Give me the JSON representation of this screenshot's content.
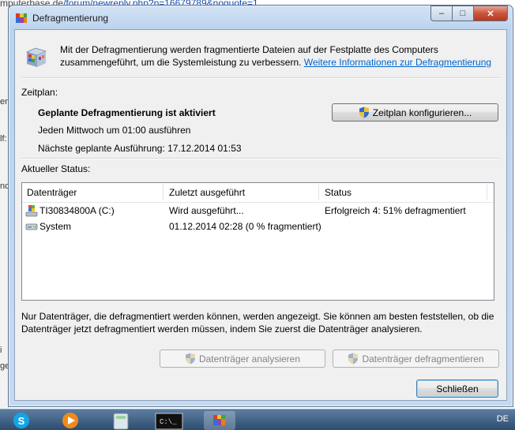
{
  "background": {
    "url_prefix": "mputerbase.de",
    "url_path": "/forum/newreply.php?p=16679789&noquote=1",
    "frag1": "en",
    "frag2": "lf:",
    "frag3": "nd",
    "frag4": "i",
    "frag5": "ge"
  },
  "window": {
    "title": "Defragmentierung",
    "minimize": "–",
    "maximize": "□",
    "close": "✕"
  },
  "intro": {
    "text": "Mit der Defragmentierung werden fragmentierte Dateien auf der Festplatte des Computers zusammengeführt, um die Systemleistung zu verbessern.",
    "link": "Weitere Informationen zur Defragmentierung"
  },
  "schedule": {
    "section_label": "Zeitplan:",
    "status": "Geplante Defragmentierung ist aktiviert",
    "run_time": "Jeden Mittwoch um 01:00 ausführen",
    "next_run": "Nächste geplante Ausführung: 17.12.2014 01:53",
    "configure_button": "Zeitplan konfigurieren..."
  },
  "current_status": {
    "section_label": "Aktueller Status:",
    "columns": [
      "Datenträger",
      "Zuletzt ausgeführt",
      "Status"
    ],
    "rows": [
      {
        "drive": "TI30834800A (C:)",
        "last_run": "Wird ausgeführt...",
        "status": "Erfolgreich 4: 51% defragmentiert",
        "icon": "windows-drive-icon"
      },
      {
        "drive": "System",
        "last_run": "01.12.2014 02:28 (0 % fragmentiert)",
        "status": "",
        "icon": "disk-drive-icon"
      }
    ]
  },
  "note": "Nur Datenträger, die defragmentiert werden können, werden angezeigt. Sie können am besten feststellen, ob die Datenträger jetzt defragmentiert werden müssen, indem Sie zuerst die Datenträger analysieren.",
  "buttons": {
    "analyze": "Datenträger analysieren",
    "defragment": "Datenträger defragmentieren",
    "close": "Schließen"
  },
  "taskbar": {
    "language": "DE",
    "items": [
      "skype-icon",
      "media-player-icon",
      "calculator-icon",
      "cmd-icon",
      "defrag-icon"
    ]
  }
}
